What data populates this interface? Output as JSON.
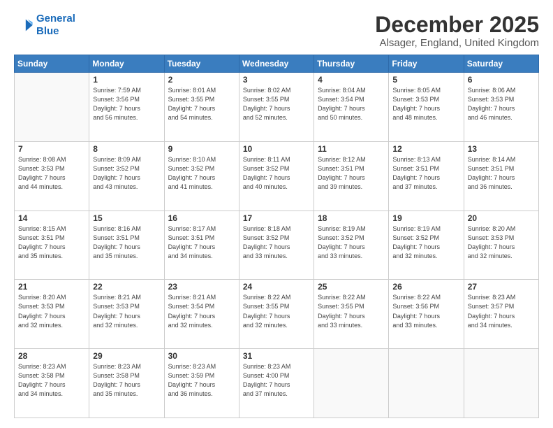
{
  "logo": {
    "line1": "General",
    "line2": "Blue"
  },
  "title": "December 2025",
  "location": "Alsager, England, United Kingdom",
  "days_header": [
    "Sunday",
    "Monday",
    "Tuesday",
    "Wednesday",
    "Thursday",
    "Friday",
    "Saturday"
  ],
  "weeks": [
    [
      {
        "day": "",
        "info": ""
      },
      {
        "day": "1",
        "info": "Sunrise: 7:59 AM\nSunset: 3:56 PM\nDaylight: 7 hours\nand 56 minutes."
      },
      {
        "day": "2",
        "info": "Sunrise: 8:01 AM\nSunset: 3:55 PM\nDaylight: 7 hours\nand 54 minutes."
      },
      {
        "day": "3",
        "info": "Sunrise: 8:02 AM\nSunset: 3:55 PM\nDaylight: 7 hours\nand 52 minutes."
      },
      {
        "day": "4",
        "info": "Sunrise: 8:04 AM\nSunset: 3:54 PM\nDaylight: 7 hours\nand 50 minutes."
      },
      {
        "day": "5",
        "info": "Sunrise: 8:05 AM\nSunset: 3:53 PM\nDaylight: 7 hours\nand 48 minutes."
      },
      {
        "day": "6",
        "info": "Sunrise: 8:06 AM\nSunset: 3:53 PM\nDaylight: 7 hours\nand 46 minutes."
      }
    ],
    [
      {
        "day": "7",
        "info": "Sunrise: 8:08 AM\nSunset: 3:53 PM\nDaylight: 7 hours\nand 44 minutes."
      },
      {
        "day": "8",
        "info": "Sunrise: 8:09 AM\nSunset: 3:52 PM\nDaylight: 7 hours\nand 43 minutes."
      },
      {
        "day": "9",
        "info": "Sunrise: 8:10 AM\nSunset: 3:52 PM\nDaylight: 7 hours\nand 41 minutes."
      },
      {
        "day": "10",
        "info": "Sunrise: 8:11 AM\nSunset: 3:52 PM\nDaylight: 7 hours\nand 40 minutes."
      },
      {
        "day": "11",
        "info": "Sunrise: 8:12 AM\nSunset: 3:51 PM\nDaylight: 7 hours\nand 39 minutes."
      },
      {
        "day": "12",
        "info": "Sunrise: 8:13 AM\nSunset: 3:51 PM\nDaylight: 7 hours\nand 37 minutes."
      },
      {
        "day": "13",
        "info": "Sunrise: 8:14 AM\nSunset: 3:51 PM\nDaylight: 7 hours\nand 36 minutes."
      }
    ],
    [
      {
        "day": "14",
        "info": "Sunrise: 8:15 AM\nSunset: 3:51 PM\nDaylight: 7 hours\nand 35 minutes."
      },
      {
        "day": "15",
        "info": "Sunrise: 8:16 AM\nSunset: 3:51 PM\nDaylight: 7 hours\nand 35 minutes."
      },
      {
        "day": "16",
        "info": "Sunrise: 8:17 AM\nSunset: 3:51 PM\nDaylight: 7 hours\nand 34 minutes."
      },
      {
        "day": "17",
        "info": "Sunrise: 8:18 AM\nSunset: 3:52 PM\nDaylight: 7 hours\nand 33 minutes."
      },
      {
        "day": "18",
        "info": "Sunrise: 8:19 AM\nSunset: 3:52 PM\nDaylight: 7 hours\nand 33 minutes."
      },
      {
        "day": "19",
        "info": "Sunrise: 8:19 AM\nSunset: 3:52 PM\nDaylight: 7 hours\nand 32 minutes."
      },
      {
        "day": "20",
        "info": "Sunrise: 8:20 AM\nSunset: 3:53 PM\nDaylight: 7 hours\nand 32 minutes."
      }
    ],
    [
      {
        "day": "21",
        "info": "Sunrise: 8:20 AM\nSunset: 3:53 PM\nDaylight: 7 hours\nand 32 minutes."
      },
      {
        "day": "22",
        "info": "Sunrise: 8:21 AM\nSunset: 3:53 PM\nDaylight: 7 hours\nand 32 minutes."
      },
      {
        "day": "23",
        "info": "Sunrise: 8:21 AM\nSunset: 3:54 PM\nDaylight: 7 hours\nand 32 minutes."
      },
      {
        "day": "24",
        "info": "Sunrise: 8:22 AM\nSunset: 3:55 PM\nDaylight: 7 hours\nand 32 minutes."
      },
      {
        "day": "25",
        "info": "Sunrise: 8:22 AM\nSunset: 3:55 PM\nDaylight: 7 hours\nand 33 minutes."
      },
      {
        "day": "26",
        "info": "Sunrise: 8:22 AM\nSunset: 3:56 PM\nDaylight: 7 hours\nand 33 minutes."
      },
      {
        "day": "27",
        "info": "Sunrise: 8:23 AM\nSunset: 3:57 PM\nDaylight: 7 hours\nand 34 minutes."
      }
    ],
    [
      {
        "day": "28",
        "info": "Sunrise: 8:23 AM\nSunset: 3:58 PM\nDaylight: 7 hours\nand 34 minutes."
      },
      {
        "day": "29",
        "info": "Sunrise: 8:23 AM\nSunset: 3:58 PM\nDaylight: 7 hours\nand 35 minutes."
      },
      {
        "day": "30",
        "info": "Sunrise: 8:23 AM\nSunset: 3:59 PM\nDaylight: 7 hours\nand 36 minutes."
      },
      {
        "day": "31",
        "info": "Sunrise: 8:23 AM\nSunset: 4:00 PM\nDaylight: 7 hours\nand 37 minutes."
      },
      {
        "day": "",
        "info": ""
      },
      {
        "day": "",
        "info": ""
      },
      {
        "day": "",
        "info": ""
      }
    ]
  ]
}
